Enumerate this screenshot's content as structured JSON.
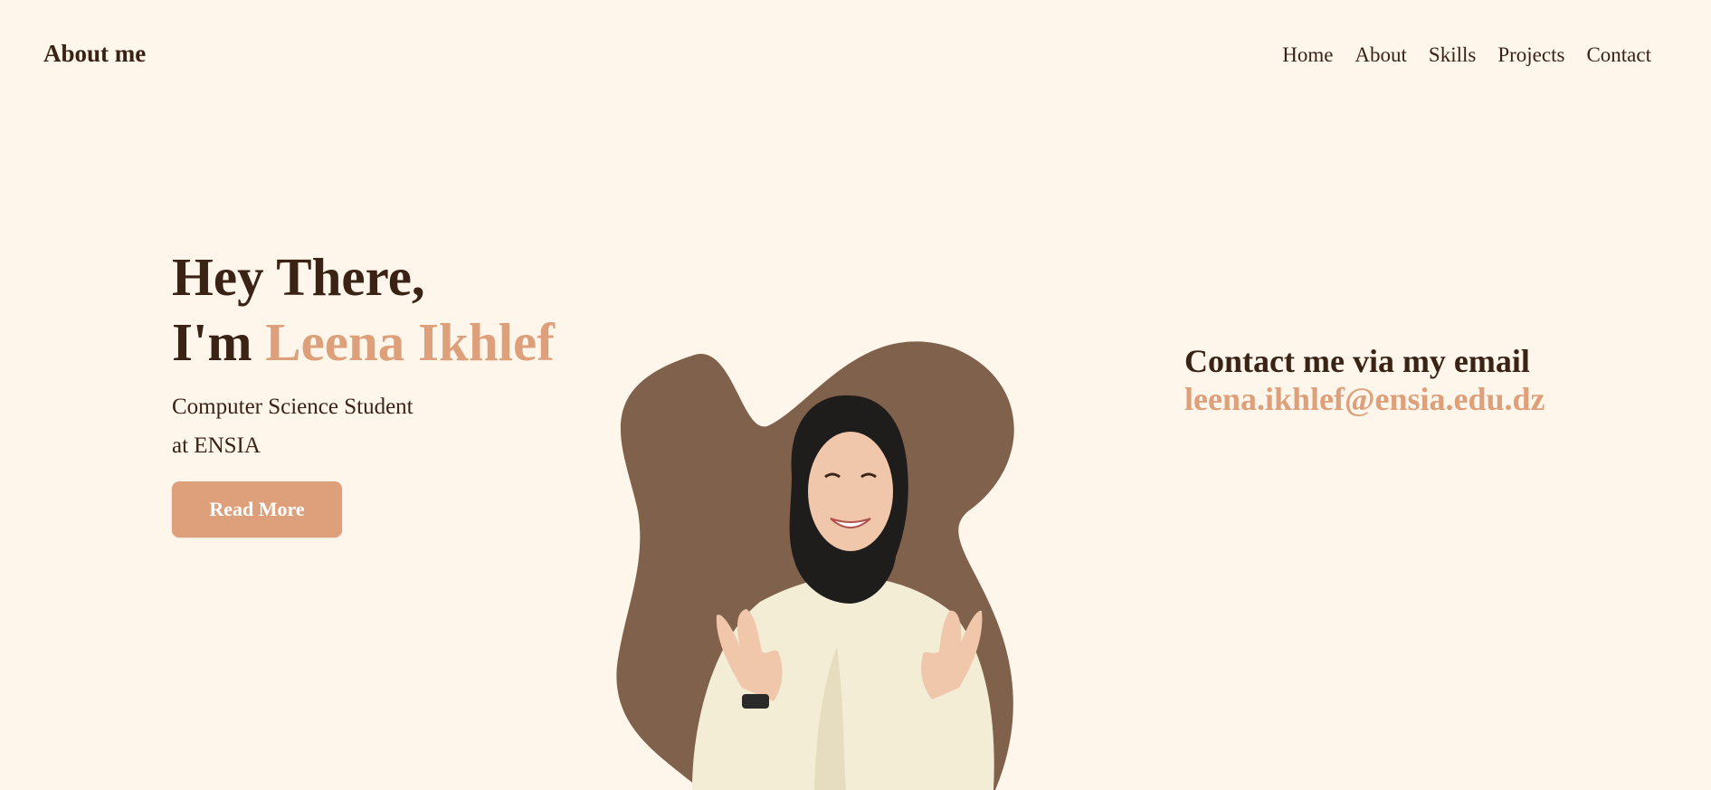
{
  "header": {
    "brand": "About me",
    "nav": [
      {
        "label": "Home"
      },
      {
        "label": "About"
      },
      {
        "label": "Skills"
      },
      {
        "label": "Projects"
      },
      {
        "label": "Contact"
      }
    ]
  },
  "hero": {
    "greeting": "Hey There,",
    "intro_prefix": "I'm ",
    "name": "Leena Ikhlef",
    "subtitle_line1": "Computer Science Student",
    "subtitle_line2": "at ENSIA",
    "button_label": "Read More"
  },
  "contact": {
    "heading": "Contact me via my email",
    "email": "leena.ikhlef@ensia.edu.dz"
  },
  "colors": {
    "background": "#fef6eb",
    "text_dark": "#3a2215",
    "accent": "#dea07a",
    "blob": "#80614c"
  }
}
